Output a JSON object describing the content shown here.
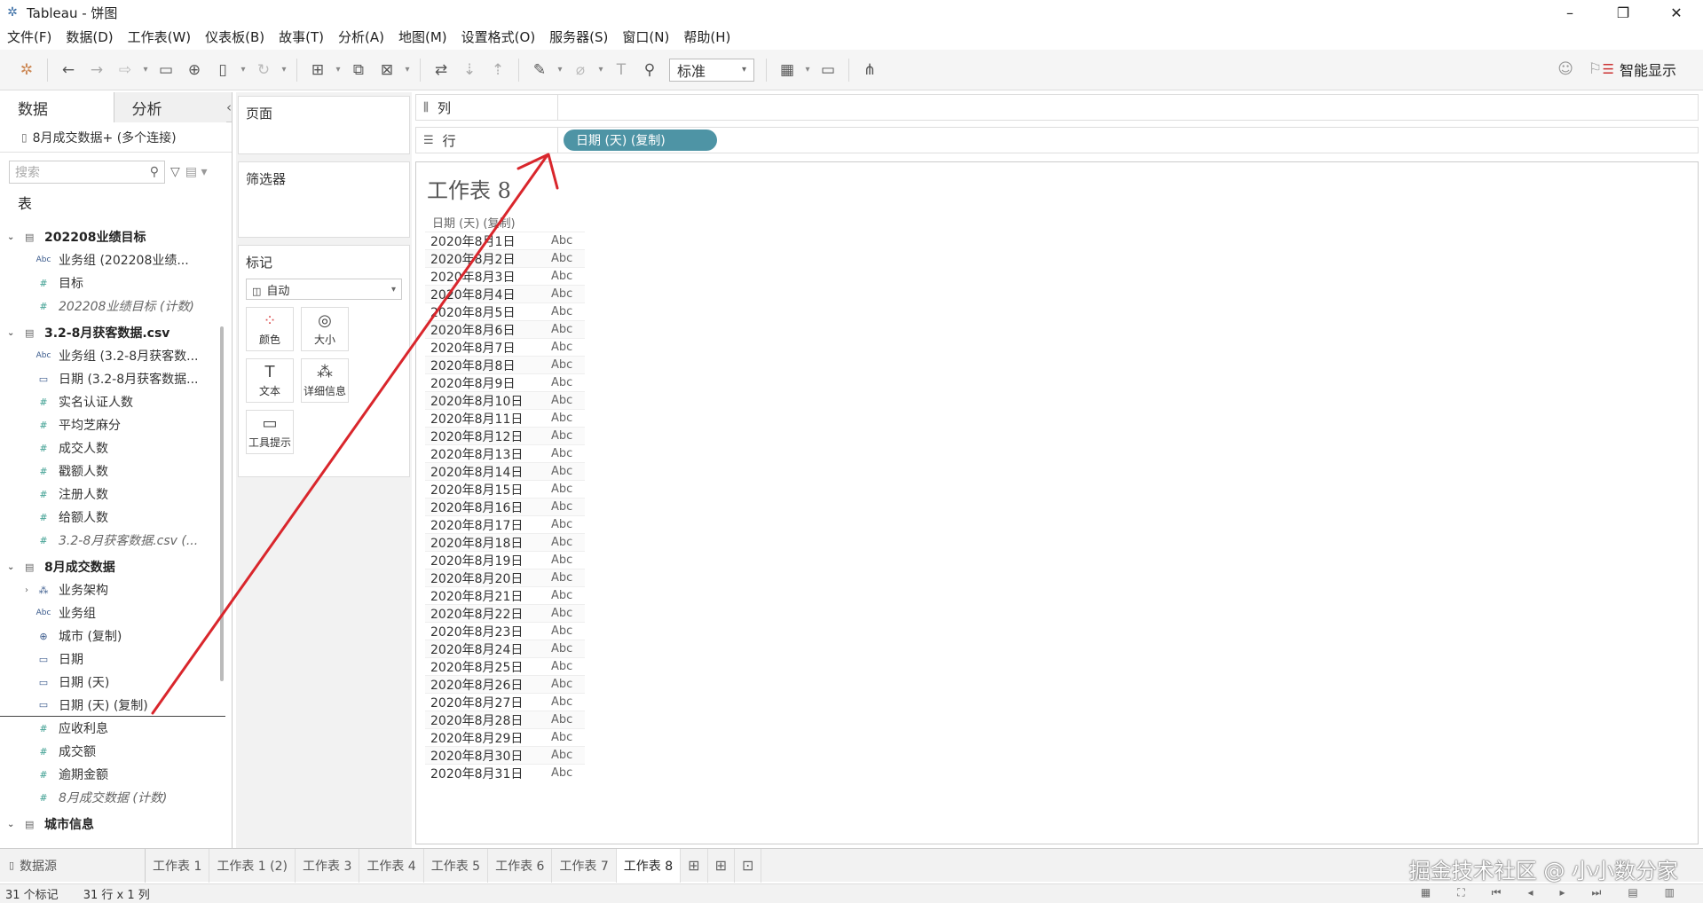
{
  "titlebar": {
    "title": "Tableau - 饼图"
  },
  "menu": [
    "文件(F)",
    "数据(D)",
    "工作表(W)",
    "仪表板(B)",
    "故事(T)",
    "分析(A)",
    "地图(M)",
    "设置格式(O)",
    "服务器(S)",
    "窗口(N)",
    "帮助(H)"
  ],
  "toolbar": {
    "fit": "标准",
    "smart_show": "智能显示"
  },
  "datapane": {
    "tab_data": "数据",
    "tab_analysis": "分析",
    "connection": "8月成交数据+ (多个连接)",
    "search_placeholder": "搜索",
    "tables_header": "表",
    "fields": [
      {
        "kind": "table",
        "label": "202208业绩目标"
      },
      {
        "kind": "abc",
        "label": "业务组 (202208业绩..."
      },
      {
        "kind": "num",
        "label": "目标"
      },
      {
        "kind": "numi",
        "label": "202208业绩目标 (计数)"
      },
      {
        "kind": "table",
        "label": "3.2-8月获客数据.csv"
      },
      {
        "kind": "abc",
        "label": "业务组 (3.2-8月获客数..."
      },
      {
        "kind": "date",
        "label": "日期 (3.2-8月获客数据..."
      },
      {
        "kind": "num",
        "label": "实名认证人数"
      },
      {
        "kind": "num",
        "label": "平均芝麻分"
      },
      {
        "kind": "num",
        "label": "成交人数"
      },
      {
        "kind": "num",
        "label": "戳额人数"
      },
      {
        "kind": "num",
        "label": "注册人数"
      },
      {
        "kind": "num",
        "label": "给额人数"
      },
      {
        "kind": "numi",
        "label": "3.2-8月获客数据.csv (..."
      },
      {
        "kind": "table",
        "label": "8月成交数据"
      },
      {
        "kind": "hier",
        "label": "业务架构"
      },
      {
        "kind": "abc",
        "label": "业务组"
      },
      {
        "kind": "geo",
        "label": "城市 (复制)"
      },
      {
        "kind": "date",
        "label": "日期"
      },
      {
        "kind": "date",
        "label": "日期 (天)"
      },
      {
        "kind": "datesel",
        "label": "日期 (天) (复制)"
      },
      {
        "kind": "num",
        "label": "应收利息"
      },
      {
        "kind": "num",
        "label": "成交额"
      },
      {
        "kind": "num",
        "label": "逾期金额"
      },
      {
        "kind": "numi",
        "label": "8月成交数据 (计数)"
      },
      {
        "kind": "table",
        "label": "城市信息"
      }
    ]
  },
  "cards": {
    "pages": "页面",
    "filters": "筛选器",
    "marks": "标记",
    "mark_type": "自动",
    "mark_buttons": [
      {
        "icon": "color-icon",
        "label": "颜色"
      },
      {
        "icon": "size-icon",
        "label": "大小"
      },
      {
        "icon": "text-icon",
        "label": "文本"
      },
      {
        "icon": "detail-icon",
        "label": "详细信息"
      },
      {
        "icon": "tooltip-icon",
        "label": "工具提示"
      }
    ]
  },
  "shelves": {
    "columns_label": "列",
    "rows_label": "行",
    "rows_pill": "日期 (天) (复制)"
  },
  "view": {
    "title": "工作表 8",
    "column_header": "日期 (天) (复制)",
    "rows": [
      "2020年8月1日",
      "2020年8月2日",
      "2020年8月3日",
      "2020年8月4日",
      "2020年8月5日",
      "2020年8月6日",
      "2020年8月7日",
      "2020年8月8日",
      "2020年8月9日",
      "2020年8月10日",
      "2020年8月11日",
      "2020年8月12日",
      "2020年8月13日",
      "2020年8月14日",
      "2020年8月15日",
      "2020年8月16日",
      "2020年8月17日",
      "2020年8月18日",
      "2020年8月19日",
      "2020年8月20日",
      "2020年8月21日",
      "2020年8月22日",
      "2020年8月23日",
      "2020年8月24日",
      "2020年8月25日",
      "2020年8月26日",
      "2020年8月27日",
      "2020年8月28日",
      "2020年8月29日",
      "2020年8月30日",
      "2020年8月31日"
    ],
    "cell_value": "Abc"
  },
  "sheet_tabs": {
    "datasource": "数据源",
    "tabs": [
      "工作表 1",
      "工作表 1 (2)",
      "工作表 3",
      "工作表 4",
      "工作表 5",
      "工作表 6",
      "工作表 7",
      "工作表 8"
    ],
    "active": "工作表 8"
  },
  "status": {
    "marks": "31 个标记",
    "dims": "31 行 x 1 列"
  },
  "watermark": "掘金技术社区 @ 小小数分家",
  "annotation_color": "#d9262c",
  "pill_color": "#4e94a5"
}
